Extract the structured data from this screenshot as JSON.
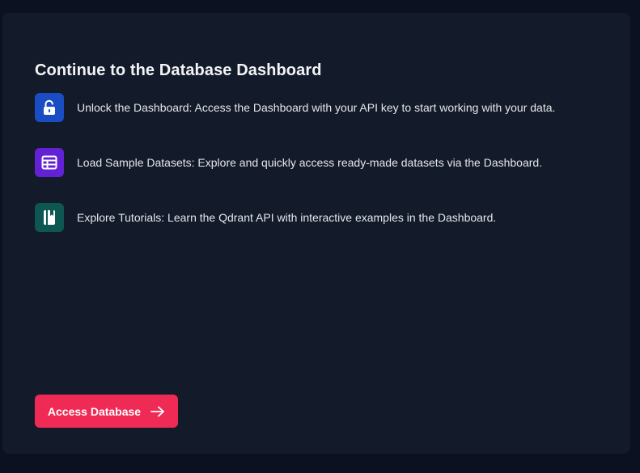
{
  "card": {
    "title": "Continue to the Database Dashboard",
    "features": [
      {
        "icon": "unlock-icon",
        "color": "#1d4ed8",
        "text": "Unlock the Dashboard: Access the Dashboard with your API key to start working with your data."
      },
      {
        "icon": "table-icon",
        "color": "#6d28d9",
        "text": "Load Sample Datasets: Explore and quickly access ready-made datasets via the Dashboard."
      },
      {
        "icon": "notebook-icon",
        "color": "#0f5a56",
        "text": "Explore Tutorials: Learn the Qdrant API with interactive examples in the Dashboard."
      }
    ],
    "cta": {
      "label": "Access Database",
      "icon": "arrow-right-icon",
      "color": "#ef2b55"
    }
  }
}
